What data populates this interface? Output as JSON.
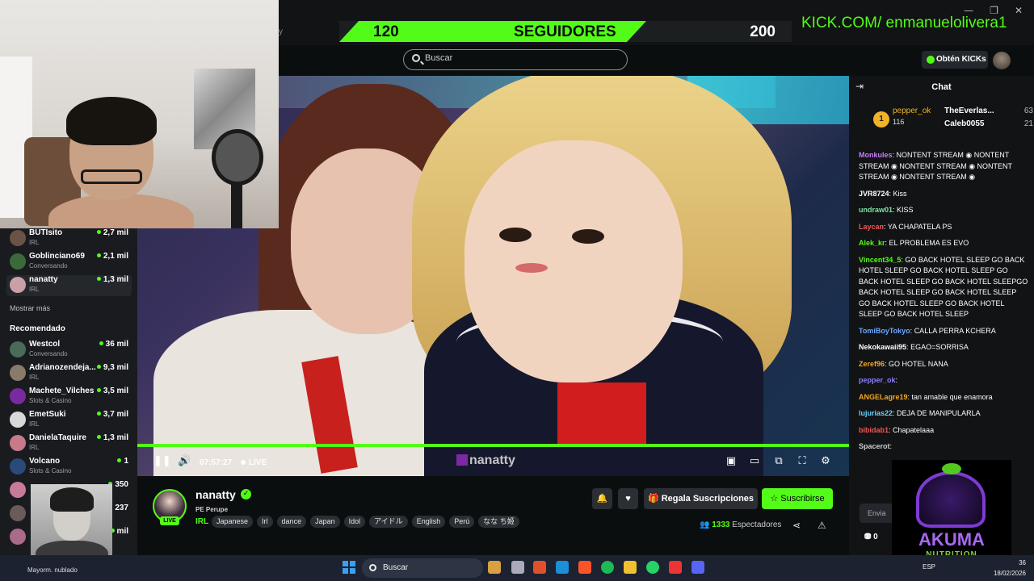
{
  "overlay": {
    "followers_current": "120",
    "followers_label": "SEGUIDORES",
    "followers_goal": "200",
    "followers_progress": 0.6,
    "kick_url": "KICK.COM/ enmanuelolivera1"
  },
  "header": {
    "search_placeholder": "Buscar",
    "get_kicks_label": "Obtén KICKs",
    "accent": "#53fc18"
  },
  "sidebar": {
    "following": [
      {
        "name": "BUTIsito",
        "category": "IRL",
        "viewers": "2,7 mil",
        "color": "#6b5246"
      },
      {
        "name": "Goblinciano69",
        "category": "Conversando",
        "viewers": "2,1 mil",
        "color": "#3a6a3a"
      },
      {
        "name": "nanatty",
        "category": "IRL",
        "viewers": "1,3 mil",
        "color": "#c9a0a8"
      }
    ],
    "show_more": "Mostrar más",
    "recommended_heading": "Recomendado",
    "recommended": [
      {
        "name": "Westcol",
        "category": "Conversando",
        "viewers": "36 mil",
        "color": "#4a6a5a"
      },
      {
        "name": "Adrianozendeja...",
        "category": "IRL",
        "viewers": "9,3 mil",
        "color": "#8a7a6a"
      },
      {
        "name": "Machete_Vilches",
        "category": "Slots & Casino",
        "viewers": "3,5 mil",
        "color": "#7a2aa0"
      },
      {
        "name": "EmetSuki",
        "category": "IRL",
        "viewers": "3,7 mil",
        "color": "#d8d8d8"
      },
      {
        "name": "DanielaTaquire",
        "category": "IRL",
        "viewers": "1,3 mil",
        "color": "#c87a8a"
      },
      {
        "name": "Volcano",
        "category": "Slots & Casino",
        "viewers": "1",
        "color": "#2a4a7a"
      }
    ],
    "hidden_counts": [
      "350",
      "237",
      "mil"
    ]
  },
  "video": {
    "time": "07:57:27",
    "live_label": "LIVE",
    "progress": 1.0,
    "watermark": "nanatty"
  },
  "channel": {
    "name": "nanatty",
    "live_badge": "LIVE",
    "country": "PE Perupe",
    "category": "IRL",
    "tags": [
      "Japanese",
      "Irl",
      "dance",
      "Japan",
      "Idol",
      "アイドル",
      "English",
      "Perú",
      "なな ち姫"
    ],
    "gift_subs_label": "Regala Suscripciones",
    "subscribe_label": "Suscribirse",
    "viewers_count": "1333",
    "viewers_label": "Espectadores"
  },
  "chat": {
    "title": "Chat",
    "pinned": {
      "rank": "1",
      "user": "pepper_ok",
      "sub": "116",
      "gifters": [
        {
          "name": "TheEverlas...",
          "count": "63"
        },
        {
          "name": "Caleb0055",
          "count": "21"
        }
      ]
    },
    "messages": [
      {
        "user": "Monkules",
        "color": "#c87dfa",
        "text": "NONTENT STREAM ◉ NONTENT STREAM ◉ NONTENT STREAM ◉ NONTENT STREAM ◉ NONTENT STREAM ◉"
      },
      {
        "user": "JVR8724",
        "color": "#ffffff",
        "text": "Kiss"
      },
      {
        "user": "undraw01",
        "color": "#7ee0a0",
        "text": "KISS"
      },
      {
        "user": "Laycan",
        "color": "#f25757",
        "text": "YA CHAPATELA PS"
      },
      {
        "user": "Alek_kr",
        "color": "#53fc18",
        "text": "EL PROBLEMA ES EVO"
      },
      {
        "user": "Vincent34_5",
        "color": "#53fc18",
        "text": "GO BACK HOTEL SLEEP GO BACK HOTEL SLEEP GO BACK HOTEL SLEEP GO BACK HOTEL SLEEP GO BACK HOTEL SLEEPGO BACK HOTEL SLEEP GO BACK HOTEL SLEEP GO BACK HOTEL SLEEP GO BACK HOTEL SLEEP GO BACK HOTEL SLEEP"
      },
      {
        "user": "TomiBoyTokyo",
        "color": "#6aa8ff",
        "text": "CALLA PERRA KCHERA"
      },
      {
        "user": "Nekokawaii95",
        "color": "#ffffff",
        "text": "EGAO=SORRISA"
      },
      {
        "user": "Zeref96",
        "color": "#f5a623",
        "text": "GO HOTEL NANA"
      },
      {
        "user": "pepper_ok",
        "color": "#8a7dff",
        "text": ""
      },
      {
        "user": "ANGELagre19",
        "color": "#f5a623",
        "text": "tan amable que enamora"
      },
      {
        "user": "lujurias22",
        "color": "#6ad0ff",
        "text": "DEJA DE MANIPULARLA"
      },
      {
        "user": "bibidab1",
        "color": "#f25757",
        "text": "Chapatelaaa"
      },
      {
        "user": "Spacerot",
        "color": "#cccccc",
        "text": ""
      }
    ],
    "input_placeholder": "Envia",
    "count": "0"
  },
  "promo": {
    "brand": "AKUMA",
    "tagline": "NUTRITION"
  },
  "taskbar": {
    "weather": "Mayorm. nublado",
    "search_label": "Buscar",
    "lang": "ESP",
    "time": "36",
    "date": "18/02/2026"
  }
}
